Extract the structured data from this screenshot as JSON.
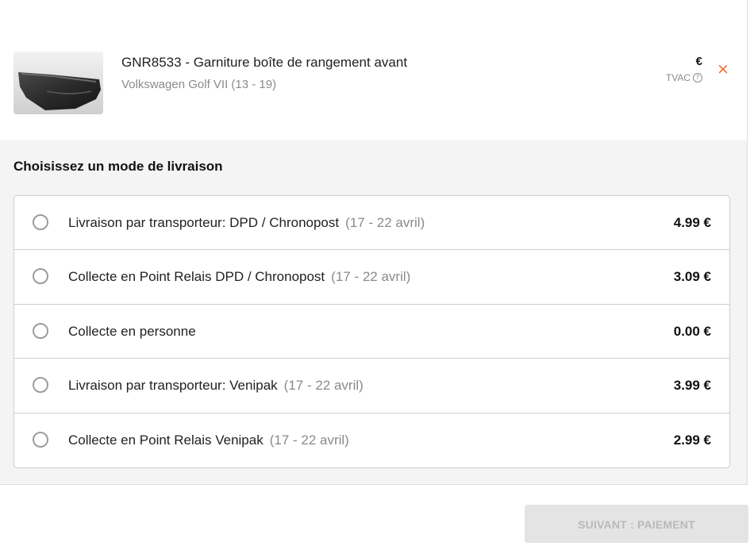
{
  "product": {
    "title": "GNR8533 - Garniture boîte de rangement avant",
    "subtitle": "Volkswagen Golf VII (13 - 19)",
    "currency": "€",
    "tax_label": "TVAC",
    "help_icon": "?",
    "remove_icon": "×"
  },
  "delivery": {
    "heading": "Choisissez un mode de livraison",
    "options": [
      {
        "label": "Livraison par transporteur: DPD / Chronopost",
        "date": "(17 - 22 avril)",
        "price": "4.99 €"
      },
      {
        "label": "Collecte en Point Relais DPD / Chronopost",
        "date": "(17 - 22 avril)",
        "price": "3.09 €"
      },
      {
        "label": "Collecte en personne",
        "date": "",
        "price": "0.00 €"
      },
      {
        "label": "Livraison par transporteur: Venipak",
        "date": "(17 - 22 avril)",
        "price": "3.99 €"
      },
      {
        "label": "Collecte en Point Relais Venipak",
        "date": "(17 - 22 avril)",
        "price": "2.99 €"
      }
    ]
  },
  "footer": {
    "next_label": "SUIVANT : PAIEMENT"
  },
  "colors": {
    "accent": "#ea6a25",
    "panel_bg": "#f4f4f4",
    "button_disabled_bg": "#e4e4e4",
    "button_disabled_text": "#b9b9b9"
  }
}
